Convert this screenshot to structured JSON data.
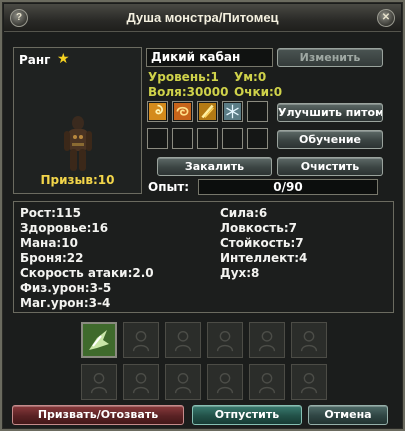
{
  "window": {
    "title": "Душа монстра/Питомец",
    "help_glyph": "?",
    "close_glyph": "✕"
  },
  "pet": {
    "rank_label": "Ранг",
    "rank_star": "★",
    "name": "Дикий кабан",
    "level": "Уровень:1",
    "intellect_top": "Ум:0",
    "will": "Воля:30000",
    "points": "Очки:0",
    "summon": "Призыв:10"
  },
  "buttons": {
    "change": "Изменить",
    "upgrade": "Улучшить питомца",
    "training": "Обучение",
    "temper": "Закалить",
    "clear": "Очистить",
    "summon_recall": "Призвать/Отозвать",
    "release": "Отпустить",
    "cancel": "Отмена"
  },
  "experience": {
    "label": "Опыт:",
    "value": "0/90",
    "fraction": 0
  },
  "skills": {
    "row1": [
      "swirl-icon",
      "spiral-icon",
      "slash-icon",
      "frost-icon",
      "empty"
    ],
    "row2": [
      "empty",
      "empty",
      "empty",
      "empty",
      "empty",
      "empty"
    ]
  },
  "stats": {
    "left": [
      "Рост:115",
      "Здоровье:16",
      "Мана:10",
      "Броня:22",
      "Скорость атаки:2.0",
      "Физ.урон:3-5",
      "Маг.урон:3-4"
    ],
    "right": [
      "Сила:6",
      "Ловкость:7",
      "Стойкость:7",
      "Интеллект:4",
      "Дух:8"
    ]
  },
  "inventory": {
    "slots": 12,
    "filled_index": 0,
    "filled_icon": "claw-icon"
  },
  "colors": {
    "accent_yellow": "#cfd24a",
    "summon_yellow": "#f2d54a",
    "star": "#f5d221"
  }
}
